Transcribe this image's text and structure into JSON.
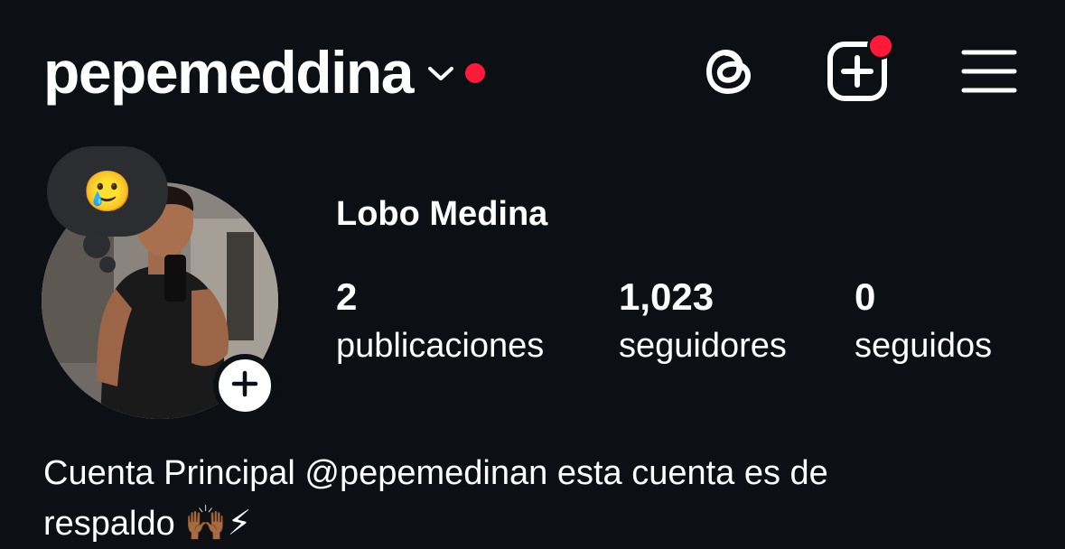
{
  "header": {
    "username": "pepemeddina",
    "icons": {
      "dropdown": "chevron-down-icon",
      "notification": "red-dot",
      "threads": "threads-icon",
      "create": "plus-square-icon",
      "menu": "hamburger-menu-icon"
    }
  },
  "profile": {
    "note_emoji": "🥲",
    "full_name": "Lobo Medina",
    "stats": {
      "posts_count": "2",
      "posts_label": "publicaciones",
      "followers_count": "1,023",
      "followers_label": "seguidores",
      "following_count": "0",
      "following_label": "seguidos"
    },
    "bio_line1": "Cuenta Principal @pepemedinan esta cuenta es de",
    "bio_line2": "respaldo 🙌🏾⚡"
  },
  "colors": {
    "background": "#0c0f14",
    "notification": "#ff1a3c",
    "note_bubble": "#2b2d31"
  }
}
